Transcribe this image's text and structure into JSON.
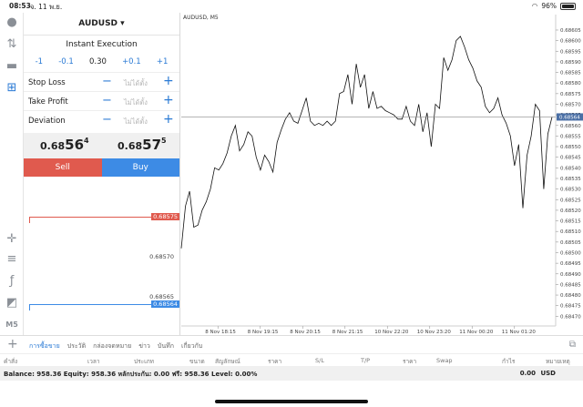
{
  "status": {
    "time": "08:53",
    "date": "จ. 11 พ.ย.",
    "battery": "96%"
  },
  "trade": {
    "symbol": "AUDUSD",
    "execution": "Instant Execution",
    "volume_steps": [
      "-1",
      "-0.1",
      "0.30",
      "+0.1",
      "+1"
    ],
    "volume_value": "0.30",
    "params": [
      {
        "label": "Stop Loss",
        "value": "ไม่ได้ตั้ง"
      },
      {
        "label": "Take Profit",
        "value": "ไม่ได้ตั้ง"
      },
      {
        "label": "Deviation",
        "value": "ไม่ได้ตั้ง"
      }
    ],
    "bid": {
      "main": "0.68",
      "big": "56",
      "sup": "4"
    },
    "ask": {
      "main": "0.68",
      "big": "57",
      "sup": "5"
    },
    "sell_label": "Sell",
    "buy_label": "Buy",
    "levels": [
      {
        "price": "0.68575",
        "kind": "ask-tag"
      },
      {
        "price": "0.68570",
        "kind": "label"
      },
      {
        "price": "0.68565",
        "kind": "label"
      },
      {
        "price": "0.68564",
        "kind": "bid-tag"
      }
    ]
  },
  "chart": {
    "title": "AUDUSD, M5",
    "y_ticks": [
      "0.68605",
      "0.68600",
      "0.68595",
      "0.68590",
      "0.68585",
      "0.68580",
      "0.68575",
      "0.68570",
      "0.68565",
      "0.68560",
      "0.68555",
      "0.68550",
      "0.68545",
      "0.68540",
      "0.68535",
      "0.68530",
      "0.68525",
      "0.68520",
      "0.68515",
      "0.68510",
      "0.68505",
      "0.68500",
      "0.68495",
      "0.68490",
      "0.68485",
      "0.68480",
      "0.68475",
      "0.68470"
    ],
    "current_price": "0.68564",
    "x_ticks": [
      "8 Nov 18:15",
      "8 Nov 19:15",
      "8 Nov 20:15",
      "8 Nov 21:15",
      "10 Nov 22:20",
      "10 Nov 23:20",
      "11 Nov 00:20",
      "11 Nov 01:20"
    ],
    "colors": {
      "line": "#111111",
      "bid": "#3d8be5",
      "ask": "#e05a4e"
    }
  },
  "chart_data": {
    "type": "line",
    "title": "AUDUSD, M5",
    "xlabel": "",
    "ylabel": "",
    "ylim": [
      0.68468,
      0.68608
    ],
    "grid": false,
    "series": [
      {
        "values": [
          0.68502,
          0.68522,
          0.68529,
          0.68512,
          0.68513,
          0.6852,
          0.68524,
          0.6853,
          0.6854,
          0.68539,
          0.68542,
          0.68547,
          0.68555,
          0.6856,
          0.68548,
          0.68551,
          0.68557,
          0.68555,
          0.68545,
          0.68539,
          0.68546,
          0.68543,
          0.68538,
          0.68552,
          0.68558,
          0.68563,
          0.68566,
          0.68562,
          0.68561,
          0.68567,
          0.68573,
          0.68562,
          0.6856,
          0.68561,
          0.6856,
          0.68562,
          0.6856,
          0.68562,
          0.68575,
          0.68576,
          0.68584,
          0.6857,
          0.68589,
          0.68578,
          0.68584,
          0.68568,
          0.68576,
          0.68568,
          0.68569,
          0.68567,
          0.68566,
          0.68565,
          0.68563,
          0.68563,
          0.68569,
          0.68562,
          0.6856,
          0.6857,
          0.68557,
          0.68566,
          0.6855,
          0.6857,
          0.68568,
          0.68592,
          0.68586,
          0.68591,
          0.686,
          0.68602,
          0.68597,
          0.68591,
          0.68587,
          0.68581,
          0.68578,
          0.68569,
          0.68566,
          0.68568,
          0.68573,
          0.68565,
          0.68561,
          0.68555,
          0.68541,
          0.68551,
          0.68521,
          0.68546,
          0.68555,
          0.6857,
          0.68567,
          0.6853,
          0.68556,
          0.68564
        ]
      }
    ]
  },
  "bottom": {
    "tabs": [
      "การซื้อขาย",
      "ประวัติ",
      "กล่องจดหมาย",
      "ข่าว",
      "บันทึก",
      "เกี่ยวกับ"
    ],
    "columns": [
      "คำสั่ง",
      "เวลา",
      "ประเภท",
      "ขนาด",
      "สัญลักษณ์",
      "ราคา",
      "S/L",
      "T/P",
      "ราคา",
      "Swap",
      "กำไร",
      "หมายเหตุ"
    ],
    "balance_text": "Balance: 958.36 Equity: 958.36 หลักประกัน: 0.00 ฟรี: 958.36 Level: 0.00%",
    "profit": "0.00",
    "currency": "USD"
  }
}
